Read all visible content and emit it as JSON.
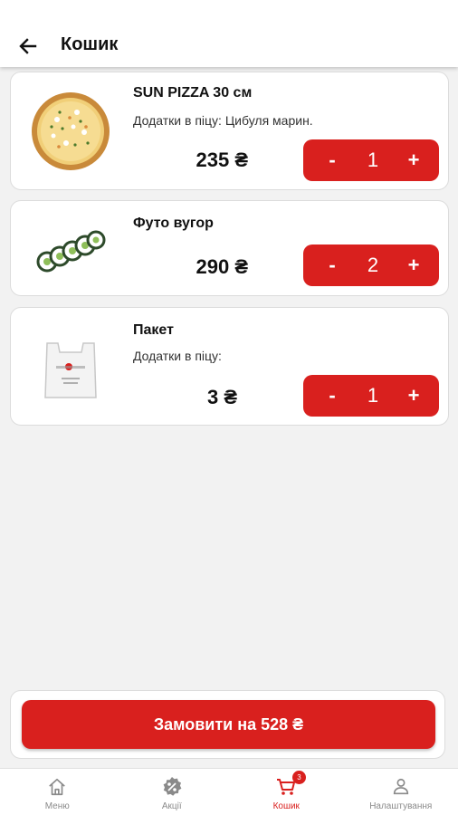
{
  "header": {
    "title": "Кошик"
  },
  "items": [
    {
      "name": "SUN PIZZA 30 см",
      "addons": "Додатки в піцу: Цибуля марин.",
      "price": "235 ₴",
      "minus": "-",
      "qty": "1",
      "plus": "+"
    },
    {
      "name": "Футо вугор",
      "price": "290 ₴",
      "minus": "-",
      "qty": "2",
      "plus": "+"
    },
    {
      "name": "Пакет",
      "addons": "Додатки в піцу:",
      "price": "3 ₴",
      "minus": "-",
      "qty": "1",
      "plus": "+"
    }
  ],
  "order": {
    "label": "Замовити на 528 ₴"
  },
  "nav": {
    "items": [
      {
        "label": "Меню",
        "icon": "home-icon"
      },
      {
        "label": "Акції",
        "icon": "discount-badge-icon"
      },
      {
        "label": "Кошик",
        "icon": "cart-icon",
        "badge": "3",
        "active": true
      },
      {
        "label": "Налаштування",
        "icon": "profile-icon"
      }
    ]
  },
  "colors": {
    "accent": "#d9201e",
    "background": "#f2f2f2",
    "card": "#ffffff",
    "inactive": "#8a8a8a"
  }
}
